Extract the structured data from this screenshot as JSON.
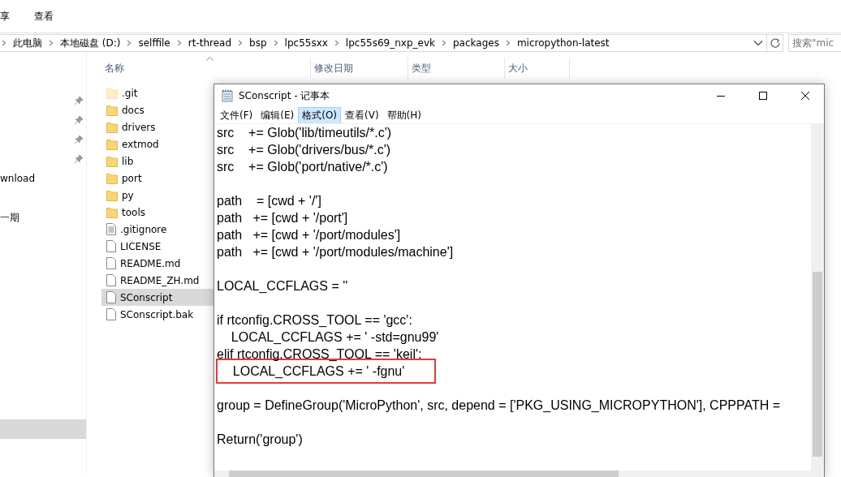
{
  "explorer": {
    "ribbon_tabs": [
      {
        "label": "享",
        "selected": false
      },
      {
        "label": "查看",
        "selected": false
      }
    ],
    "breadcrumb": [
      "此电脑",
      "本地磁盘 (D:)",
      "selffile",
      "rt-thread",
      "bsp",
      "lpc55sxx",
      "lpc55s69_nxp_evk",
      "packages",
      "micropython-latest"
    ],
    "search": {
      "placeholder": "搜索\"mic"
    },
    "nav_items": [
      {
        "label": "wnload",
        "selected": false
      },
      {
        "label": "一期",
        "selected": false
      },
      {
        "selected": true
      }
    ],
    "columns": [
      "名称",
      "修改日期",
      "类型",
      "大小"
    ],
    "files": [
      {
        "name": ".git",
        "kind": "folder",
        "hidden": true,
        "selected": false
      },
      {
        "name": "docs",
        "kind": "folder",
        "hidden": false,
        "selected": false
      },
      {
        "name": "drivers",
        "kind": "folder",
        "hidden": false,
        "selected": false
      },
      {
        "name": "extmod",
        "kind": "folder",
        "hidden": false,
        "selected": false
      },
      {
        "name": "lib",
        "kind": "folder",
        "hidden": false,
        "selected": false
      },
      {
        "name": "port",
        "kind": "folder",
        "hidden": false,
        "selected": false
      },
      {
        "name": "py",
        "kind": "folder",
        "hidden": false,
        "selected": false
      },
      {
        "name": "tools",
        "kind": "folder",
        "hidden": false,
        "selected": false
      },
      {
        "name": ".gitignore",
        "kind": "text",
        "hidden": false,
        "selected": false
      },
      {
        "name": "LICENSE",
        "kind": "file",
        "hidden": false,
        "selected": false
      },
      {
        "name": "README.md",
        "kind": "file",
        "hidden": false,
        "selected": false
      },
      {
        "name": "README_ZH.md",
        "kind": "file",
        "hidden": false,
        "selected": false
      },
      {
        "name": "SConscript",
        "kind": "file",
        "hidden": false,
        "selected": true
      },
      {
        "name": "SConscript.bak",
        "kind": "file",
        "hidden": false,
        "selected": false
      }
    ]
  },
  "notepad": {
    "title": "SConscript - 记事本",
    "menu": [
      {
        "label": "文件(F)",
        "selected": false
      },
      {
        "label": "编辑(E)",
        "selected": false
      },
      {
        "label": "格式(O)",
        "selected": true
      },
      {
        "label": "查看(V)",
        "selected": false
      },
      {
        "label": "帮助(H)",
        "selected": false
      }
    ],
    "code_blocks": [
      [
        {
          "text": "src    += Glob('lib/timeutils/*.c')",
          "highlighted": false
        },
        {
          "text": "src    += Glob('drivers/bus/*.c')",
          "highlighted": false
        },
        {
          "text": "src    += Glob('port/native/*.c')",
          "highlighted": false
        }
      ],
      [
        {
          "text": "path    = [cwd + '/']",
          "highlighted": false
        },
        {
          "text": "path   += [cwd + '/port']",
          "highlighted": false
        },
        {
          "text": "path   += [cwd + '/port/modules']",
          "highlighted": false
        },
        {
          "text": "path   += [cwd + '/port/modules/machine']",
          "highlighted": false
        }
      ],
      [
        {
          "text": "LOCAL_CCFLAGS = ''",
          "highlighted": false
        }
      ],
      [
        {
          "text": "if rtconfig.CROSS_TOOL == 'gcc':",
          "highlighted": false
        },
        {
          "text": "    LOCAL_CCFLAGS += ' -std=gnu99'",
          "highlighted": false
        },
        {
          "text": "elif rtconfig.CROSS_TOOL == 'keil':",
          "highlighted": false
        },
        {
          "text": "    LOCAL_CCFLAGS += ' -fgnu'",
          "highlighted": true
        }
      ],
      [
        {
          "text": "group = DefineGroup('MicroPython', src, depend = ['PKG_USING_MICROPYTHON'], CPPPATH =",
          "highlighted": false
        }
      ],
      [
        {
          "text": "Return('group')",
          "highlighted": false
        }
      ]
    ]
  }
}
